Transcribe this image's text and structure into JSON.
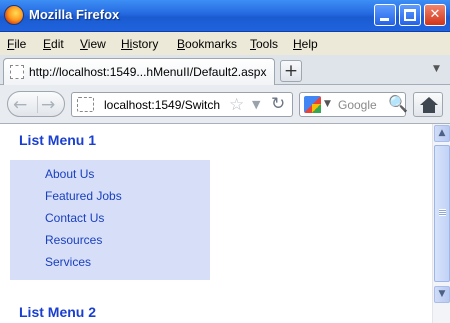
{
  "window": {
    "title": "Mozilla Firefox",
    "minimize_label": "",
    "maximize_label": "",
    "close_label": "✕"
  },
  "menubar": {
    "items": [
      {
        "label_first": "F",
        "label_rest": "ile"
      },
      {
        "label_first": "E",
        "label_rest": "dit"
      },
      {
        "label_first": "V",
        "label_rest": "iew"
      },
      {
        "label_first": "Hi",
        "label_rest": "story"
      },
      {
        "label_first": "B",
        "label_rest": "ookmarks"
      },
      {
        "label_first": "T",
        "label_rest": "ools"
      },
      {
        "label_first": "H",
        "label_rest": "elp"
      }
    ]
  },
  "tabs": {
    "active_title": "http://localhost:1549...hMenuII/Default2.aspx",
    "new_tab_label": "+",
    "list_arrow": "▼"
  },
  "navbar": {
    "back_icon": "←",
    "forward_icon": "→",
    "url": "localhost:1549/Switch",
    "star_icon": "☆",
    "dropdown_icon": "▼",
    "reload_icon": "↻",
    "search_placeholder": "Google",
    "search_drop": "▼",
    "search_icon": "🔍"
  },
  "content": {
    "menu1": {
      "heading": "List Menu 1",
      "items": [
        "About Us",
        "Featured Jobs",
        "Contact Us",
        "Resources",
        "Services"
      ]
    },
    "menu2": {
      "heading": "List Menu 2"
    }
  },
  "scrollbar": {
    "up_arrow": "▲",
    "down_arrow": "▼"
  }
}
